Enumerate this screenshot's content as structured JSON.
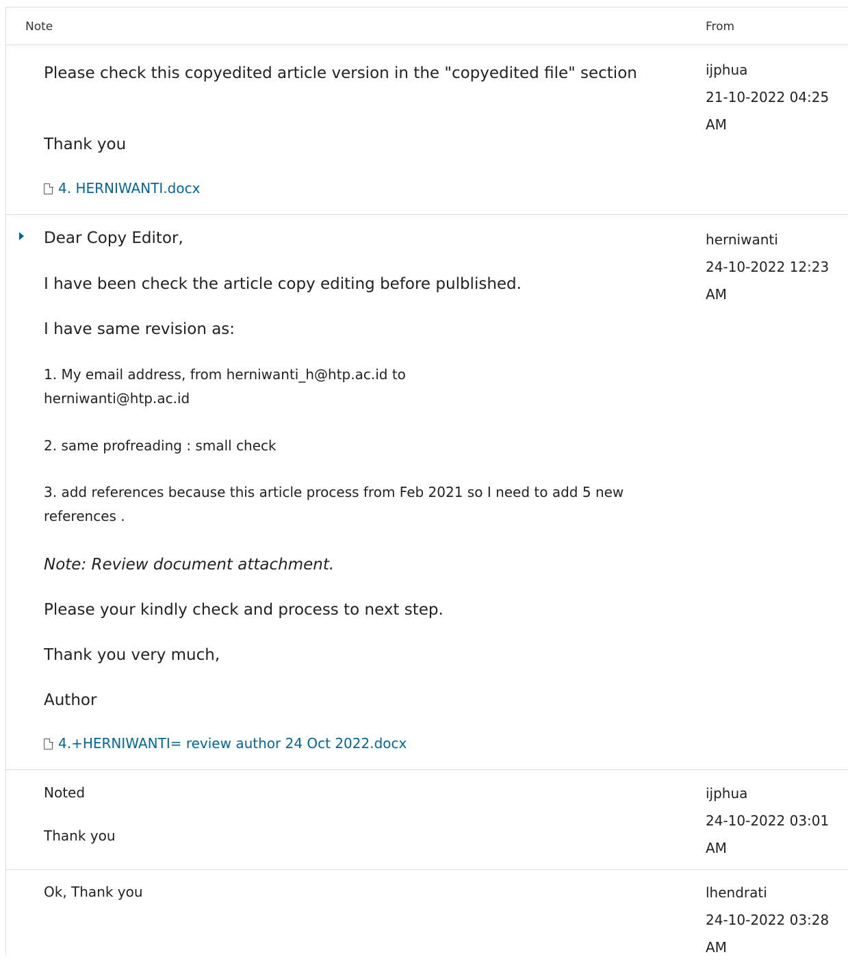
{
  "table": {
    "col_note": "Note",
    "col_from": "From"
  },
  "notes": [
    {
      "paragraphs": [
        "Please check this copyedited article version in the \"copyedited file\" section",
        "Thank you"
      ],
      "attachment": "4. HERNIWANTI.docx",
      "from_user": "ijphua",
      "from_date": "21-10-2022 04:25",
      "from_time": "AM"
    },
    {
      "paragraphs": [
        "Dear Copy Editor,",
        "I have been check the article copy editing before pulblished.",
        "I have same revision as:",
        "1. My  email address, from herniwanti_h@htp.ac.id to herniwanti@htp.ac.id",
        "2. same profreading : small check",
        "3. add references because this article process from Feb 2021 so I need to add 5  new references .",
        "Note: Review document attachment.",
        "Please your kindly check and process to next step.",
        "Thank you very much,",
        "Author"
      ],
      "attachment": "4.+HERNIWANTI= review author 24 Oct 2022.docx",
      "from_user": "herniwanti",
      "from_date": "24-10-2022 12:23",
      "from_time": "AM"
    },
    {
      "paragraphs": [
        "Noted",
        "Thank you"
      ],
      "from_user": "ijphua",
      "from_date": "24-10-2022 03:01",
      "from_time": "AM"
    },
    {
      "paragraphs": [
        "Ok, Thank you"
      ],
      "from_user": "lhendrati",
      "from_date": "24-10-2022 03:28",
      "from_time": "AM"
    }
  ],
  "colors": {
    "link": "#006798",
    "border": "#dddddd"
  }
}
